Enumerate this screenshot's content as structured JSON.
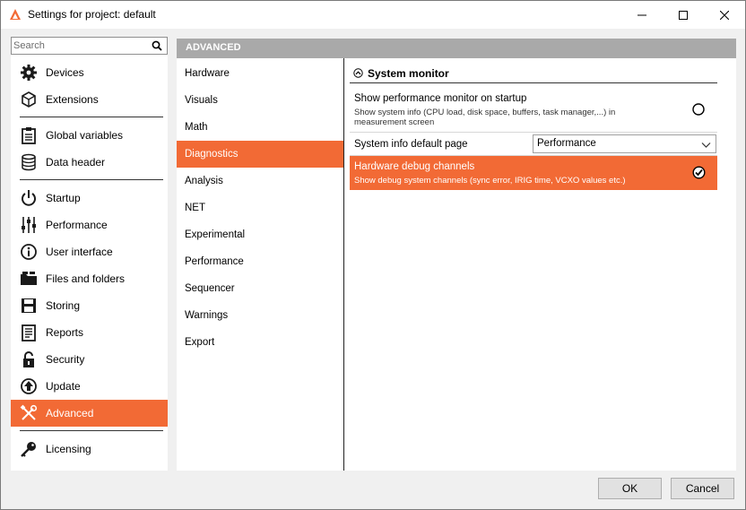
{
  "window": {
    "title": "Settings for project: default",
    "accent_color": "#f26a35"
  },
  "search": {
    "placeholder": "Search",
    "value": ""
  },
  "sidebar": {
    "items": [
      {
        "label": "Devices",
        "icon": "gear-icon"
      },
      {
        "label": "Extensions",
        "icon": "cube-icon"
      },
      {
        "label": "Global variables",
        "icon": "clipboard-icon"
      },
      {
        "label": "Data header",
        "icon": "database-icon"
      },
      {
        "label": "Startup",
        "icon": "power-icon"
      },
      {
        "label": "Performance",
        "icon": "sliders-icon"
      },
      {
        "label": "User interface",
        "icon": "info-icon"
      },
      {
        "label": "Files and folders",
        "icon": "folder-icon"
      },
      {
        "label": "Storing",
        "icon": "save-icon"
      },
      {
        "label": "Reports",
        "icon": "report-icon"
      },
      {
        "label": "Security",
        "icon": "lock-icon"
      },
      {
        "label": "Update",
        "icon": "update-icon"
      },
      {
        "label": "Advanced",
        "icon": "tools-icon",
        "active": true
      },
      {
        "label": "Licensing",
        "icon": "key-icon"
      }
    ]
  },
  "main": {
    "header": "ADVANCED",
    "subnav": [
      "Hardware",
      "Visuals",
      "Math",
      "Diagnostics",
      "Analysis",
      "NET",
      "Experimental",
      "Performance",
      "Sequencer",
      "Warnings",
      "Export"
    ],
    "active_subnav": "Diagnostics",
    "section": {
      "title": "System monitor",
      "rows": [
        {
          "title": "Show performance monitor on startup",
          "desc_line1": "Show system info (CPU load, disk space, buffers, task manager,...) in",
          "desc_line2": "measurement screen",
          "checked": false
        },
        {
          "title": "System info default page",
          "select_value": "Performance"
        },
        {
          "title": "Hardware debug channels",
          "desc_line1": "Show debug system channels (sync error, IRIG time, VCXO values etc.)",
          "checked": true
        }
      ]
    }
  },
  "footer": {
    "ok_label": "OK",
    "cancel_label": "Cancel"
  }
}
